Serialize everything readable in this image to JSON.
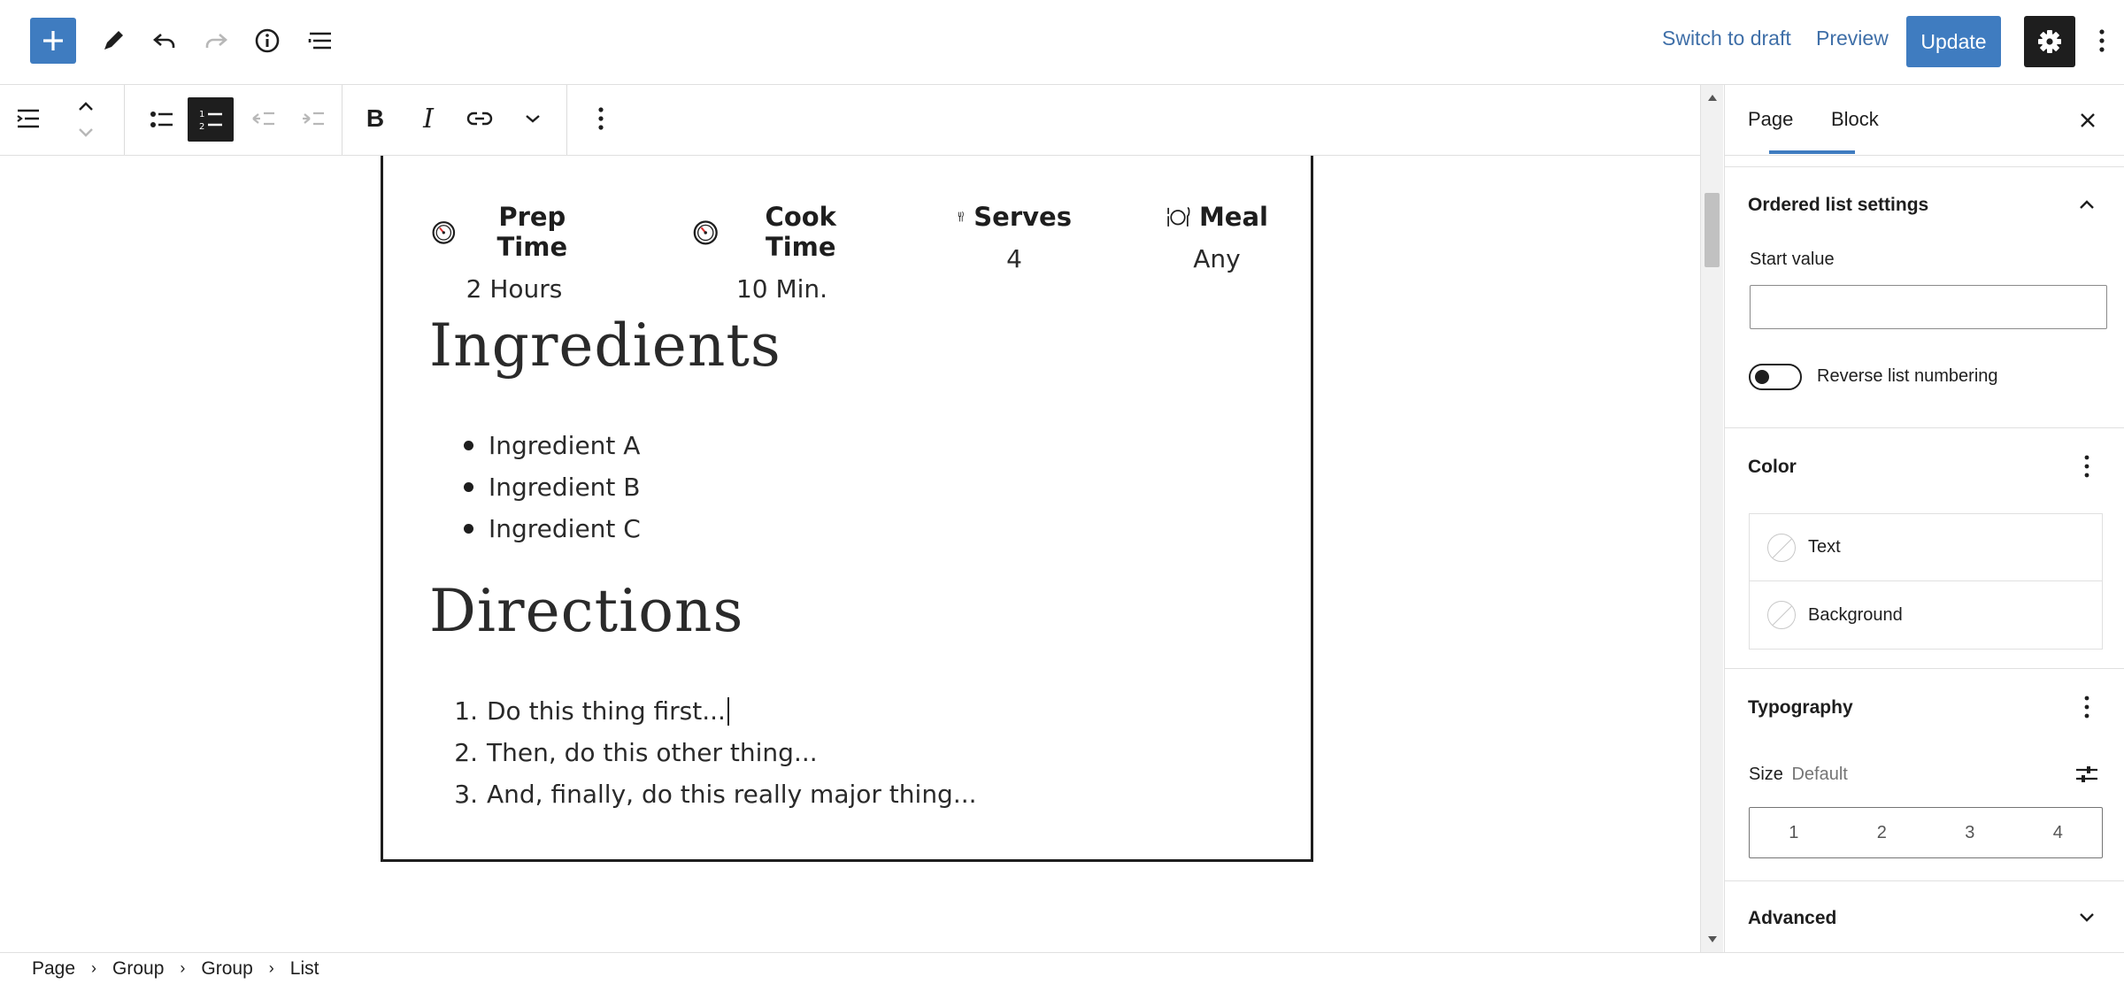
{
  "topbar": {
    "add_block_icon": "plus-icon",
    "tools_icon": "pencil-icon",
    "undo_icon": "undo-icon",
    "redo_icon": "redo-icon",
    "details_icon": "info-icon",
    "outline_icon": "list-view-icon",
    "switch_to_draft": "Switch to draft",
    "preview": "Preview",
    "update": "Update",
    "settings_icon": "gear-icon",
    "options_icon": "more-vertical-icon"
  },
  "block_toolbar": {
    "icons": [
      "list-block-icon",
      "move-up-icon",
      "move-down-icon",
      "unordered-list-icon",
      "ordered-list-icon",
      "outdent-icon",
      "indent-icon",
      "bold-icon",
      "italic-icon",
      "link-icon",
      "chevron-down-icon",
      "more-vertical-icon"
    ],
    "bold": "B",
    "italic": "I"
  },
  "recipe": {
    "meta": [
      {
        "icon": "timer-icon",
        "label": "Prep Time",
        "value": "2 Hours"
      },
      {
        "icon": "timer-icon",
        "label": "Cook Time",
        "value": "10 Min."
      },
      {
        "icon": "utensils-icon",
        "label": "Serves",
        "value": "4"
      },
      {
        "icon": "plate-icon",
        "label": "Meal",
        "value": "Any"
      }
    ],
    "ingredients_heading": "Ingredients",
    "ingredients": [
      "Ingredient A",
      "Ingredient B",
      "Ingredient C"
    ],
    "directions_heading": "Directions",
    "directions": [
      {
        "n": "1.",
        "text": "Do this thing first..."
      },
      {
        "n": "2.",
        "text": "Then, do this other thing..."
      },
      {
        "n": "3.",
        "text": "And, finally, do this really major thing..."
      }
    ]
  },
  "sidebar": {
    "tabs": [
      "Page",
      "Block"
    ],
    "active_tab": "Block",
    "close_icon": "close-icon",
    "ordered_list_settings": {
      "title": "Ordered list settings",
      "start_value_label": "Start value",
      "start_value": "",
      "reverse_label": "Reverse list numbering",
      "reverse_enabled": false
    },
    "color": {
      "title": "Color",
      "items": [
        "Text",
        "Background"
      ]
    },
    "typography": {
      "title": "Typography",
      "size_label": "Size",
      "size_value": "Default",
      "sizes": [
        "1",
        "2",
        "3",
        "4"
      ]
    },
    "advanced": {
      "title": "Advanced"
    }
  },
  "breadcrumb": [
    "Page",
    "Group",
    "Group",
    "List"
  ],
  "colors": {
    "accent": "#3f7cc0",
    "dark": "#1e1e1e",
    "border": "#e0e0e0"
  }
}
